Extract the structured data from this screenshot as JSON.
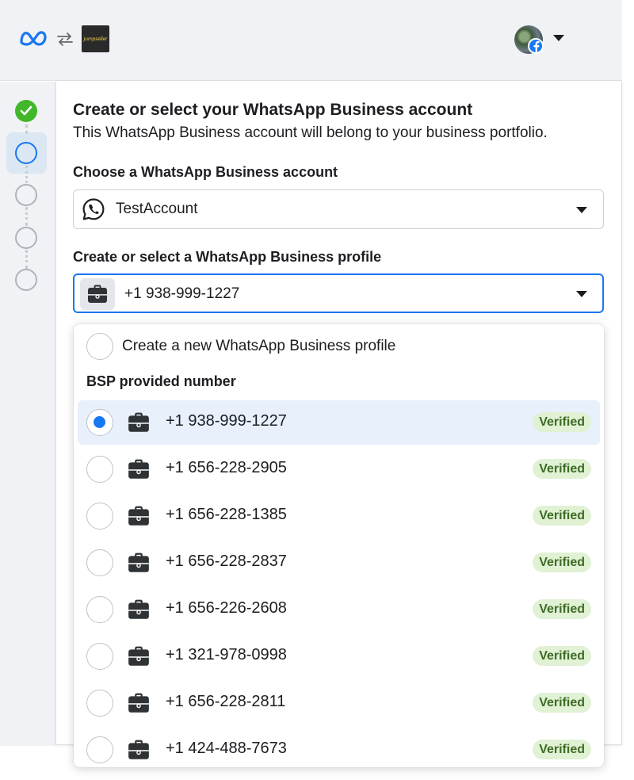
{
  "header": {
    "business_logo_text": "Jumpseller"
  },
  "steps": [
    "done",
    "current",
    "pending",
    "pending",
    "pending"
  ],
  "card": {
    "title": "Create or select your WhatsApp Business account",
    "subtitle": "This WhatsApp Business account will belong to your business portfolio."
  },
  "account_select": {
    "label": "Choose a WhatsApp Business account",
    "value": "TestAccount"
  },
  "profile_select": {
    "label": "Create or select a WhatsApp Business profile",
    "value": "+1 938-999-1227"
  },
  "dropdown": {
    "create_option": "Create a new WhatsApp Business profile",
    "section_title": "BSP provided number",
    "numbers": [
      {
        "number": "+1 938-999-1227",
        "status": "Verified",
        "selected": true
      },
      {
        "number": "+1 656-228-2905",
        "status": "Verified",
        "selected": false
      },
      {
        "number": "+1 656-228-1385",
        "status": "Verified",
        "selected": false
      },
      {
        "number": "+1 656-228-2837",
        "status": "Verified",
        "selected": false
      },
      {
        "number": "+1 656-226-2608",
        "status": "Verified",
        "selected": false
      },
      {
        "number": "+1 321-978-0998",
        "status": "Verified",
        "selected": false
      },
      {
        "number": "+1 656-228-2811",
        "status": "Verified",
        "selected": false
      },
      {
        "number": "+1 424-488-7673",
        "status": "Verified",
        "selected": false
      }
    ]
  },
  "colors": {
    "accent": "#1877f2",
    "success": "#42b72a",
    "badge_bg": "#e0f1d4",
    "badge_text": "#3e6c25",
    "selected_row": "#e7f0fb"
  },
  "icons": {
    "header": [
      "meta-logo-icon",
      "sync-icon",
      "facebook-badge-icon",
      "chevron-down-icon"
    ],
    "account": "whatsapp-icon",
    "profile": "briefcase-icon"
  }
}
